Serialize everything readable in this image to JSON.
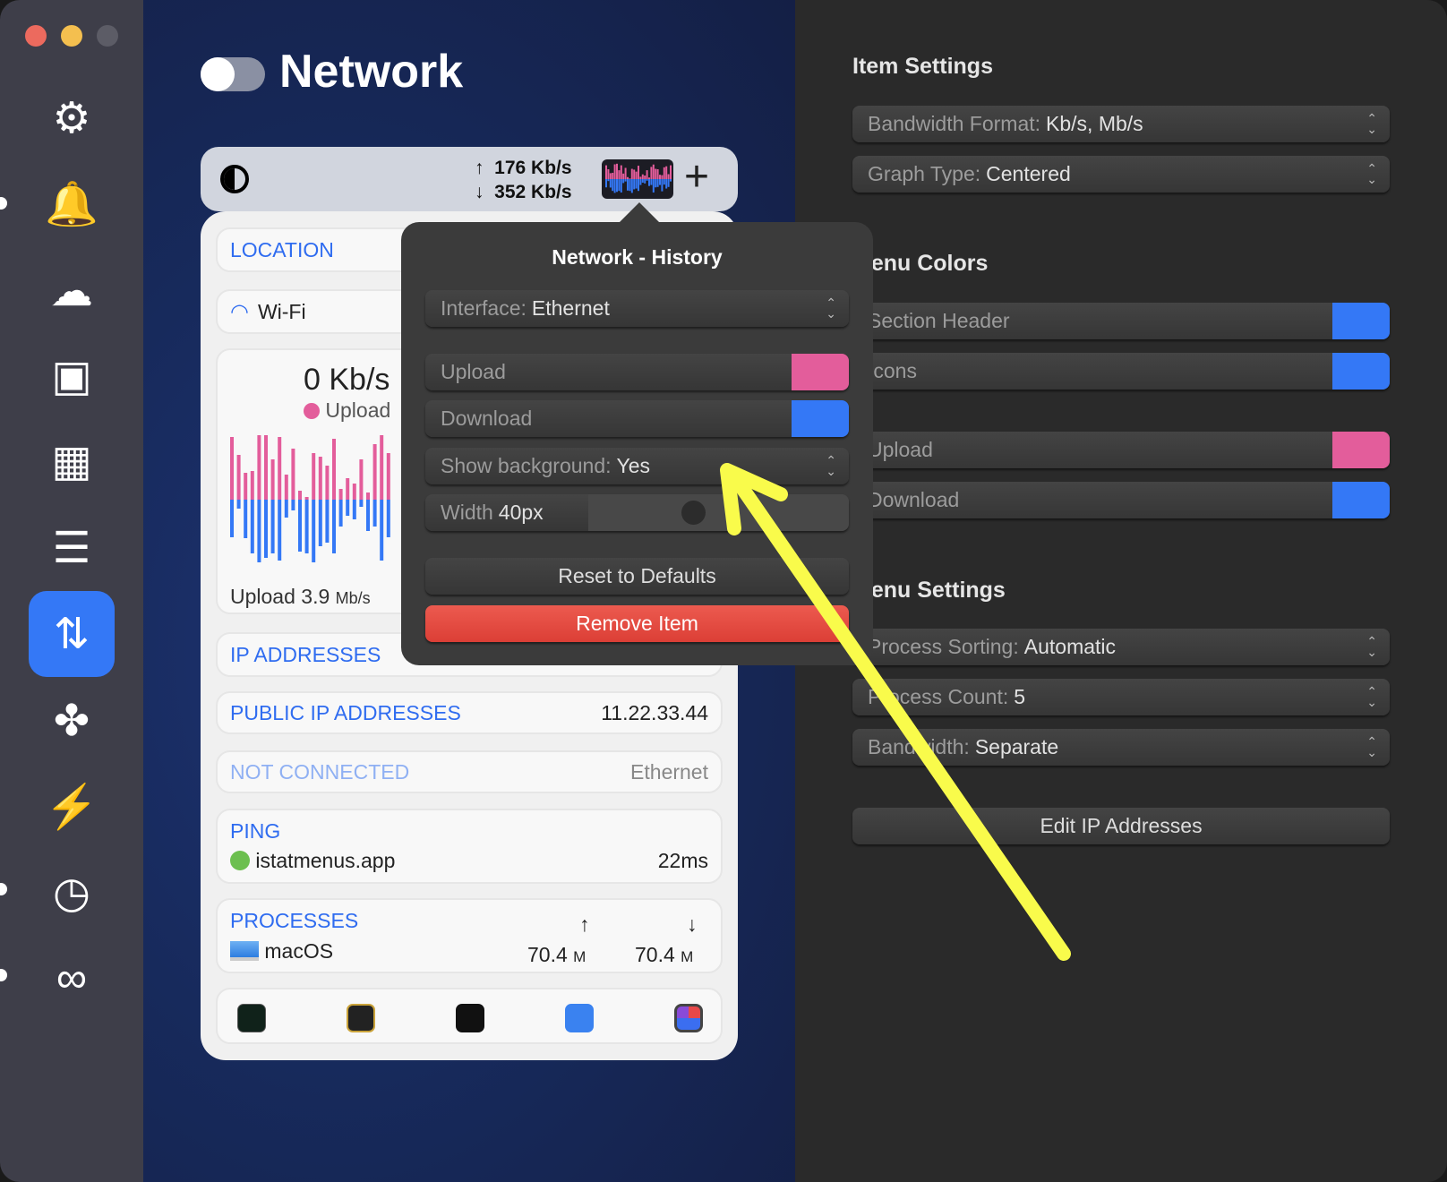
{
  "window": {
    "traffic_lights": [
      "#ec6a5e",
      "#f4bf4f",
      "#5c5c66"
    ]
  },
  "sidebar": {
    "items": [
      {
        "icon": "gear-icon",
        "glyph": "⚙"
      },
      {
        "icon": "bell-icon",
        "glyph": "🔔"
      },
      {
        "icon": "weather-icon",
        "glyph": "☁"
      },
      {
        "icon": "cpu-icon",
        "glyph": "▣"
      },
      {
        "icon": "memory-icon",
        "glyph": "▦"
      },
      {
        "icon": "disks-icon",
        "glyph": "☰"
      },
      {
        "icon": "network-icon",
        "glyph": "⇅"
      },
      {
        "icon": "fan-icon",
        "glyph": "✤"
      },
      {
        "icon": "battery-power-icon",
        "glyph": "⚡"
      },
      {
        "icon": "time-icon",
        "glyph": "◷"
      },
      {
        "icon": "combined-icon",
        "glyph": "∞"
      }
    ],
    "active_index": 6
  },
  "header": {
    "title": "Network",
    "enabled": false
  },
  "menubar": {
    "upload": "176 Kb/s",
    "download": "352 Kb/s",
    "up_arrow": "↑",
    "down_arrow": "↓",
    "add": "+"
  },
  "card": {
    "location": "LOCATION",
    "wifi": "Wi-Fi",
    "graph": {
      "rate": "0 Kb/s",
      "legend": "Upload",
      "footer_label": "Upload",
      "footer_value": "3.9",
      "footer_unit": "Mb/s",
      "upload": [
        70,
        50,
        30,
        32,
        75,
        78,
        45,
        70,
        28,
        57,
        10,
        3,
        52,
        48,
        38,
        68,
        12,
        24,
        18,
        45,
        8,
        62,
        74,
        52,
        50,
        22,
        20,
        60,
        65,
        25,
        70
      ],
      "download": [
        42,
        10,
        43,
        60,
        70,
        65,
        60,
        68,
        20,
        12,
        58,
        60,
        70,
        52,
        48,
        60,
        30,
        18,
        22,
        8,
        35,
        30,
        68,
        42,
        40,
        30,
        62,
        28,
        48,
        40,
        12
      ]
    },
    "ip_addresses": "IP ADDRESSES",
    "public_ip": {
      "label": "PUBLIC IP ADDRESSES",
      "value": "11.22.33.44"
    },
    "not_connected": {
      "label": "NOT CONNECTED",
      "value": "Ethernet"
    },
    "ping": {
      "label": "PING",
      "host": "istatmenus.app",
      "value": "22ms",
      "status_color": "#6cbf4f"
    },
    "processes": {
      "label": "PROCESSES",
      "up": "↑",
      "down": "↓",
      "rows": [
        {
          "name": "macOS",
          "up": "70.4",
          "down": "70.4",
          "unit": "M"
        }
      ]
    },
    "dock": [
      "activity-monitor-icon",
      "console-icon",
      "terminal-icon",
      "network-utility-icon",
      "istat-menus-icon"
    ]
  },
  "popover": {
    "title": "Network - History",
    "interface_label": "Interface:",
    "interface_value": "Ethernet",
    "upload": "Upload",
    "download": "Download",
    "show_bg_label": "Show background:",
    "show_bg_value": "Yes",
    "width_label": "Width",
    "width_value": "40px",
    "width_slider_percent": 40,
    "reset": "Reset to Defaults",
    "remove": "Remove Item"
  },
  "settings": {
    "item_title": "Item Settings",
    "bandwidth_label": "Bandwidth Format:",
    "bandwidth_value": "Kb/s, Mb/s",
    "graph_label": "Graph Type:",
    "graph_value": "Centered",
    "colors_title": "Menu Colors",
    "section_header": "Section Header",
    "icons": "Icons",
    "upload": "Upload",
    "download": "Download",
    "menu_title": "Menu Settings",
    "sorting_label": "Process Sorting:",
    "sorting_value": "Automatic",
    "count_label": "Process Count:",
    "count_value": "5",
    "bw_label": "Bandwidth:",
    "bw_value": "Separate",
    "edit_ip": "Edit IP Addresses"
  },
  "colors": {
    "upload": "#e35d9b",
    "download": "#3478f6",
    "accent": "#3478f6",
    "remove": "#e5483e",
    "annotation": "#f9fb4b"
  }
}
